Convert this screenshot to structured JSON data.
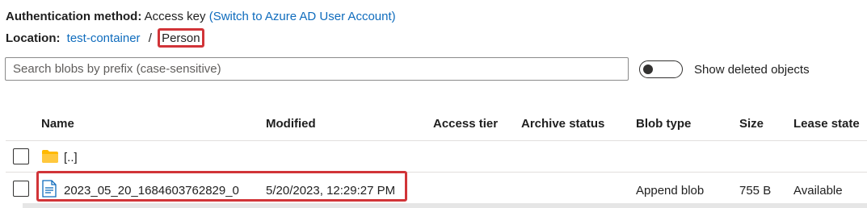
{
  "auth": {
    "label": "Authentication method:",
    "value": "Access key",
    "switch_link": "(Switch to Azure AD User Account)"
  },
  "location": {
    "label": "Location:",
    "container": "test-container",
    "separator": "/",
    "current": "Person"
  },
  "search": {
    "placeholder": "Search blobs by prefix (case-sensitive)",
    "value": ""
  },
  "show_deleted": {
    "label": "Show deleted objects",
    "on": false
  },
  "table": {
    "columns": [
      "Name",
      "Modified",
      "Access tier",
      "Archive status",
      "Blob type",
      "Size",
      "Lease state"
    ],
    "parent_row": {
      "name": "[..]"
    },
    "rows": [
      {
        "name": "2023_05_20_1684603762829_0",
        "modified": "5/20/2023, 12:29:27 PM",
        "access_tier": "",
        "archive_status": "",
        "blob_type": "Append blob",
        "size": "755 B",
        "lease_state": "Available"
      }
    ]
  },
  "colors": {
    "link": "#0f6cbd",
    "highlight": "#d13438",
    "folder": "#ffb900",
    "file_icon": "#0f6cbd"
  }
}
